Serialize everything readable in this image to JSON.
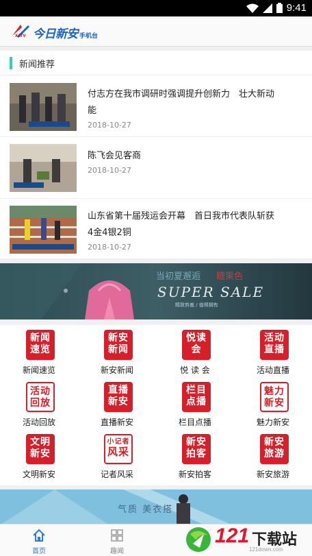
{
  "status": {
    "time": "9:41"
  },
  "app": {
    "logo_main": "今日新安",
    "logo_sub": "手机台",
    "logo_mark": "XATV"
  },
  "section": {
    "title": "新闻推荐"
  },
  "news": [
    {
      "title": "付志方在我市调研时强调提升创新力　壮大新动能",
      "date": "2018-10-27"
    },
    {
      "title": "陈飞会见客商",
      "date": "2018-10-27"
    },
    {
      "title": "山东省第十届残运会开幕　首日我市代表队斩获4金4银2铜",
      "date": "2018-10-27"
    }
  ],
  "banner1": {
    "line1": "当初夏邂逅",
    "line1_accent": "糖果色",
    "sale": "SUPER SALE",
    "small": "精致剪裁 / 值得拥有"
  },
  "grid": [
    {
      "stamp": "新闻速览",
      "label": "新闻速览",
      "style": "solid"
    },
    {
      "stamp": "新安新闻",
      "label": "新安新闻",
      "style": "solid"
    },
    {
      "stamp": "悦读会",
      "label": "悦 读 会",
      "style": "solid"
    },
    {
      "stamp": "活动直播",
      "label": "活动直播",
      "style": "solid"
    },
    {
      "stamp": "活动回放",
      "label": "活动回放",
      "style": "inv"
    },
    {
      "stamp": "直播新安",
      "label": "直播新安",
      "style": "solid"
    },
    {
      "stamp": "栏目点播",
      "label": "栏目点播",
      "style": "solid"
    },
    {
      "stamp": "魅力新安",
      "label": "魅力新安",
      "style": "inv"
    },
    {
      "stamp": "文明新安",
      "label": "文明新安",
      "style": "solid"
    },
    {
      "stamp": "小记者风采",
      "label": "记者风采",
      "style": "inv"
    },
    {
      "stamp": "新安拍客",
      "label": "新安拍客",
      "style": "solid"
    },
    {
      "stamp": "新安旅游",
      "label": "新安旅游",
      "style": "solid"
    }
  ],
  "banner2": {
    "text": "气质 美衣搭"
  },
  "tabs": [
    {
      "label": "首页",
      "icon": "home-icon",
      "active": true
    },
    {
      "label": "趣闻",
      "icon": "grid-icon",
      "active": false
    }
  ],
  "watermark": {
    "num": "121",
    "text": "下载站",
    "url": "121down.com"
  },
  "colors": {
    "accent": "#2a7ae2",
    "stamp_red": "#d4202a",
    "section_bar": "#2ad0c8"
  }
}
